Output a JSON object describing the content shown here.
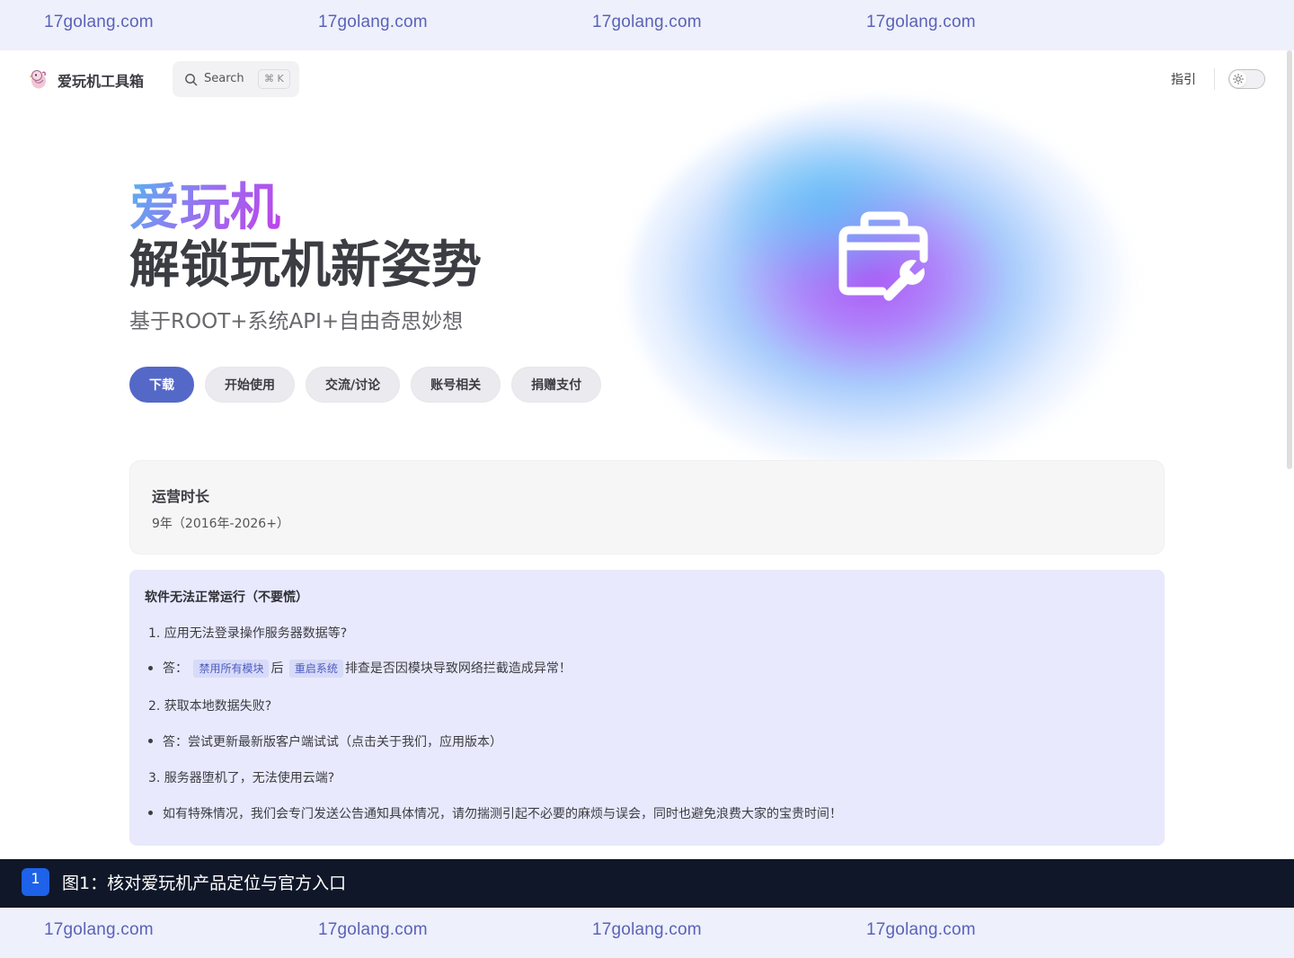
{
  "watermark": {
    "text": "17golang.com"
  },
  "navbar": {
    "site_title": "爱玩机工具箱",
    "search_label": "Search",
    "search_shortcut": "⌘ K",
    "nav_items": [
      {
        "label": "指引"
      }
    ]
  },
  "hero": {
    "name": "爱玩机",
    "text": "解锁玩机新姿势",
    "tagline": "基于ROOT+系统API+自由奇思妙想",
    "actions": [
      {
        "label": "下载",
        "theme": "brand"
      },
      {
        "label": "开始使用",
        "theme": "alt"
      },
      {
        "label": "交流/讨论",
        "theme": "alt"
      },
      {
        "label": "账号相关",
        "theme": "alt"
      },
      {
        "label": "捐赠支付",
        "theme": "alt"
      }
    ],
    "image_icon": "toolbox-wrench-icon"
  },
  "feature": {
    "title": "运营时长",
    "details": "9年（2016年-2026+）"
  },
  "notice": {
    "title": "软件无法正常运行（不要慌）",
    "q1": "1. 应用无法登录操作服务器数据等?",
    "a1_prefix": "答：",
    "a1_tag1": "禁用所有模块",
    "a1_mid": "后",
    "a1_tag2": "重启系统",
    "a1_suffix": "排查是否因模块导致网络拦截造成异常！",
    "q2": "2. 获取本地数据失败?",
    "a2": "答：尝试更新最新版客户端试试（点击关于我们，应用版本）",
    "q3": "3. 服务器堕机了，无法使用云端?",
    "a3": "如有特殊情况，我们会专门发送公告通知具体情况，请勿揣测引起不必要的麻烦与误会，同时也避免浪费大家的宝贵时间！"
  },
  "caption": {
    "number": "1",
    "text": "图1：核对爱玩机产品定位与官方入口"
  },
  "colors": {
    "brand": "#5468c8",
    "notice_bg": "#e8e9fc",
    "caption_bg": "#0f1729",
    "watermark": "#5a62b8"
  }
}
